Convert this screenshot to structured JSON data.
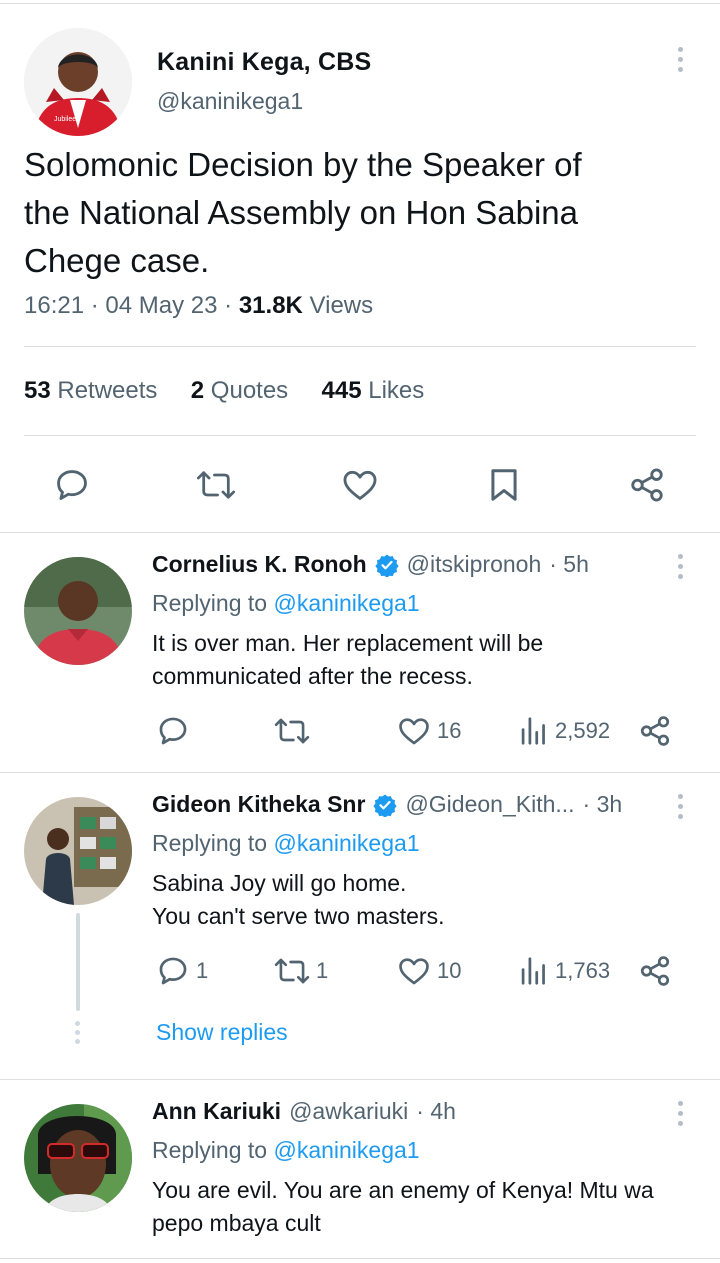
{
  "main_tweet": {
    "author_name": "Kanini Kega, CBS",
    "author_handle": "@kaninikega1",
    "text_lines": [
      "Solomonic Decision by the Speaker of",
      "the National Assembly on Hon Sabina",
      "Chege case."
    ],
    "time": "16:21",
    "sep1": "·",
    "date": "04 May 23",
    "sep2": "·",
    "views_count": "31.8K",
    "views_label": "Views",
    "retweets_count": "53",
    "retweets_label": "Retweets",
    "quotes_count": "2",
    "quotes_label": "Quotes",
    "likes_count": "445",
    "likes_label": "Likes",
    "avatar_badge_text": "Jubilee"
  },
  "replies": [
    {
      "name": "Cornelius K. Ronoh",
      "verified": true,
      "handle": "@itskipronoh",
      "time": "· 5h",
      "replying_prefix": "Replying to",
      "replying_handle": "@kaninikega1",
      "text_lines": [
        "It is over man. Her replacement will be",
        "communicated after the recess."
      ],
      "reply_count": "",
      "retweet_count": "",
      "like_count": "16",
      "view_count": "2,592"
    },
    {
      "name": "Gideon Kitheka Snr",
      "verified": true,
      "handle": "@Gideon_Kith...",
      "time": "· 3h",
      "replying_prefix": "Replying to",
      "replying_handle": "@kaninikega1",
      "text_lines": [
        "Sabina Joy will go home.",
        "You can't serve two masters."
      ],
      "reply_count": "1",
      "retweet_count": "1",
      "like_count": "10",
      "view_count": "1,763",
      "show_replies": "Show replies"
    },
    {
      "name": "Ann Kariuki",
      "verified": false,
      "handle": "@awkariuki",
      "time": "· 4h",
      "replying_prefix": "Replying to",
      "replying_handle": "@kaninikega1",
      "text_lines": [
        "You are evil. You are an enemy of Kenya! Mtu wa",
        "pepo mbaya cult"
      ]
    }
  ],
  "colors": {
    "accent": "#1d9bf0",
    "text": "#0f1419",
    "muted": "#536471",
    "divider": "#dcdfe2"
  }
}
